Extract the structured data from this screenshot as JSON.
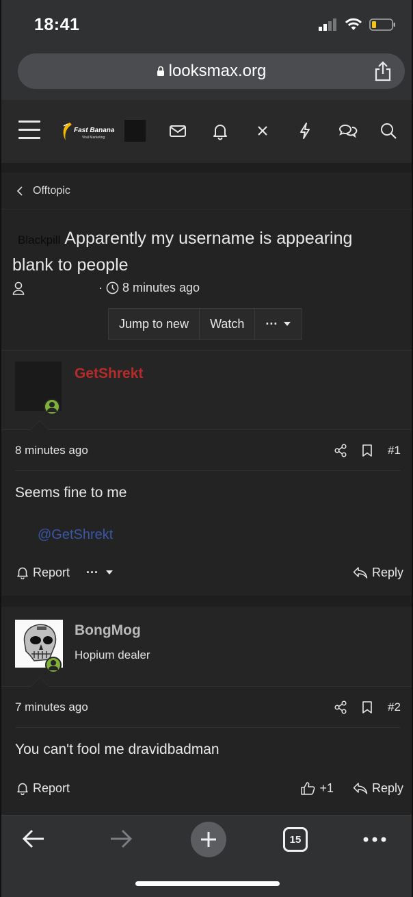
{
  "status": {
    "time": "18:41"
  },
  "browser": {
    "url": "looksmax.org",
    "tab_count": "15"
  },
  "header": {
    "logo_text": "Fast Banana",
    "logo_sub": "Viral Marketing"
  },
  "breadcrumb": {
    "label": "Offtopic"
  },
  "thread": {
    "prefix": "Blackpill",
    "title": "Apparently my username is appearing blank to people",
    "author": "",
    "time": "8 minutes ago",
    "buttons": {
      "jump": "Jump to new",
      "watch": "Watch",
      "more": "···"
    }
  },
  "posts": [
    {
      "username": "GetShrekt",
      "username_color": "#b42c2a",
      "user_title": "",
      "date": "8 minutes ago",
      "number": "#1",
      "body": "Seems fine to me",
      "mention": "@GetShrekt",
      "report": "Report",
      "more": "···",
      "reaction": "",
      "reply": "Reply"
    },
    {
      "username": "BongMog",
      "username_color": "#b9b9b9",
      "user_title": "Hopium dealer",
      "date": "7 minutes ago",
      "number": "#2",
      "body": "You can't fool me dravidbadman",
      "report": "Report",
      "reaction": "+1",
      "reply": "Reply"
    }
  ],
  "colors": {
    "background": "#232323",
    "online": "#7fb13a",
    "mention": "#3a57a8"
  },
  "icons": [
    "menu-icon",
    "envelope-icon",
    "bell-icon",
    "close-icon",
    "lightning-icon",
    "chat-bubbles-icon",
    "search-icon",
    "share-icon",
    "bookmark-icon",
    "like-icon",
    "reply-icon",
    "back-arrow-icon",
    "forward-arrow-icon",
    "new-tab-icon",
    "tabs-icon",
    "more-icon"
  ]
}
